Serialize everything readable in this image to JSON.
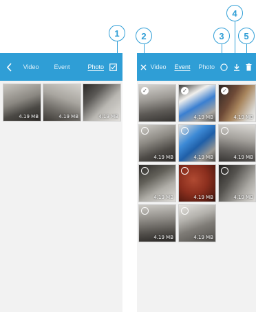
{
  "callouts": [
    "1",
    "2",
    "3",
    "4",
    "5"
  ],
  "left": {
    "back_icon": "chevron-left-icon",
    "tabs": [
      "Video",
      "Event",
      "Photo"
    ],
    "active_tab": "Photo",
    "select_icon": "checkbox-icon",
    "thumbnails": [
      {
        "size": "4.19 MB"
      },
      {
        "size": "4.19 MB"
      },
      {
        "size": "4.19 MB"
      }
    ]
  },
  "right": {
    "close_icon": "close-icon",
    "tabs": [
      "Video",
      "Event",
      "Photo"
    ],
    "active_tab": "Event",
    "toolbar_icons": [
      "select-all-circle-icon",
      "download-icon",
      "trash-icon"
    ],
    "thumbnails": [
      {
        "size": "",
        "selected": true
      },
      {
        "size": "4.19 MB",
        "selected": true
      },
      {
        "size": "4.19 MB",
        "selected": true
      },
      {
        "size": "4.19 MB",
        "selected": false
      },
      {
        "size": "4.19 MB",
        "selected": false
      },
      {
        "size": "4.19 MB",
        "selected": false
      },
      {
        "size": "4.19 MB",
        "selected": false
      },
      {
        "size": "4.19 MB",
        "selected": false
      },
      {
        "size": "4.19 MB",
        "selected": false
      },
      {
        "size": "4.19 MB",
        "selected": false
      },
      {
        "size": "4.19 MB",
        "selected": false
      }
    ]
  },
  "colors": {
    "accent": "#2f9ed6",
    "background": "#f2f2f2"
  }
}
